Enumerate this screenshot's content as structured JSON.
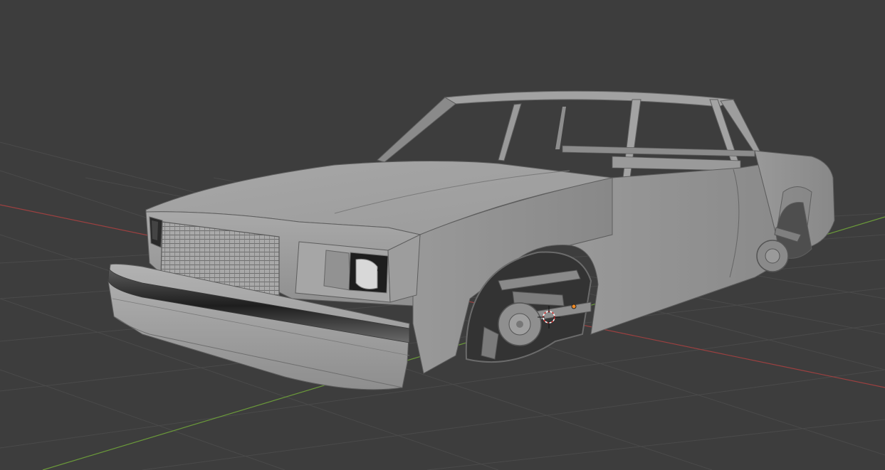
{
  "viewport": {
    "background": "#3d3d3d",
    "grid_color": "#4a4a4a",
    "x_axis_color": "#a04545",
    "y_axis_color": "#6b9a3a",
    "model_color": "#b4b4b4",
    "cursor_icon": "3d-cursor-icon",
    "origin_icon": "object-origin-icon"
  }
}
